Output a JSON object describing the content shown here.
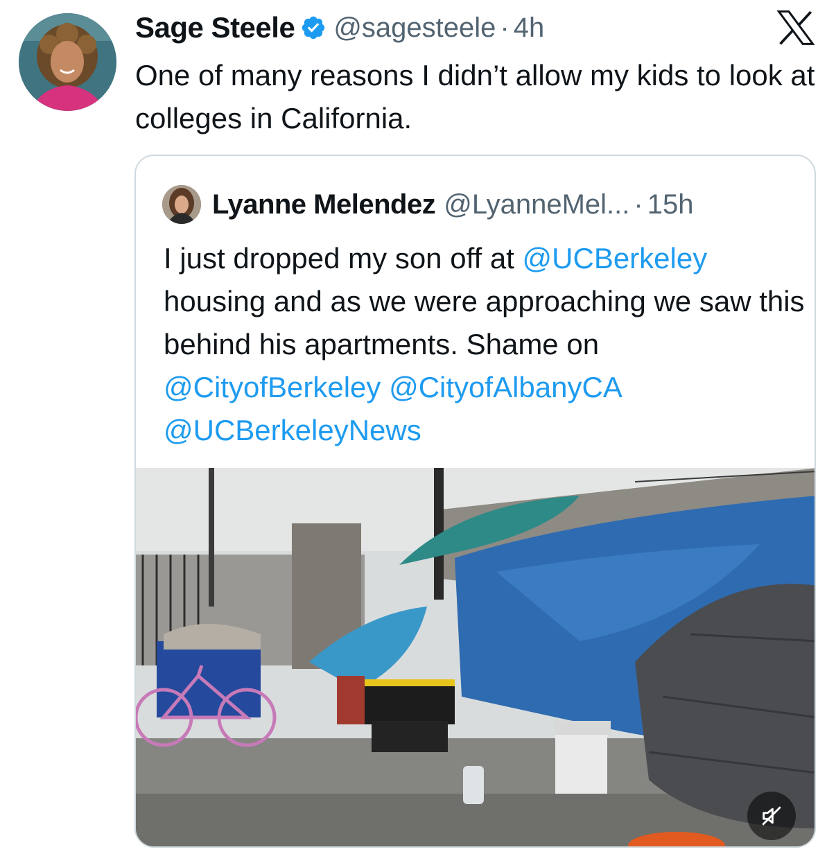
{
  "tweet": {
    "author_name": "Sage Steele",
    "handle": "@sagesteele",
    "separator": "·",
    "time": "4h",
    "text": "One of many reasons I didn’t allow my kids to look at colleges in California.",
    "avatar_icon": "profile-photo",
    "verified_icon": "verified-badge-icon",
    "brand_icon": "x-logo-icon"
  },
  "quote": {
    "author_name": "Lyanne Melendez",
    "handle": "@LyanneMel...",
    "separator": "·",
    "time": "15h",
    "text_parts": [
      {
        "text": "I just dropped my son off at ",
        "type": "text"
      },
      {
        "text": "@UCBerkeley",
        "type": "mention"
      },
      {
        "text": " housing and as we were approaching we saw this behind his apartments. Shame on ",
        "type": "text"
      },
      {
        "text": "@CityofBerkeley",
        "type": "mention"
      },
      {
        "text": " ",
        "type": "text"
      },
      {
        "text": "@CityofAlbanyCA",
        "type": "mention"
      },
      {
        "text": " ",
        "type": "text"
      },
      {
        "text": "@UCBerkeleyNews",
        "type": "mention"
      }
    ],
    "media_icon": "video-thumbnail",
    "mute_icon": "muted-speaker-icon"
  },
  "colors": {
    "link": "#1d9bf0",
    "verified": "#1d9bf0",
    "secondary_text": "#536471",
    "border": "#cfd9de",
    "text": "#0f1419"
  }
}
